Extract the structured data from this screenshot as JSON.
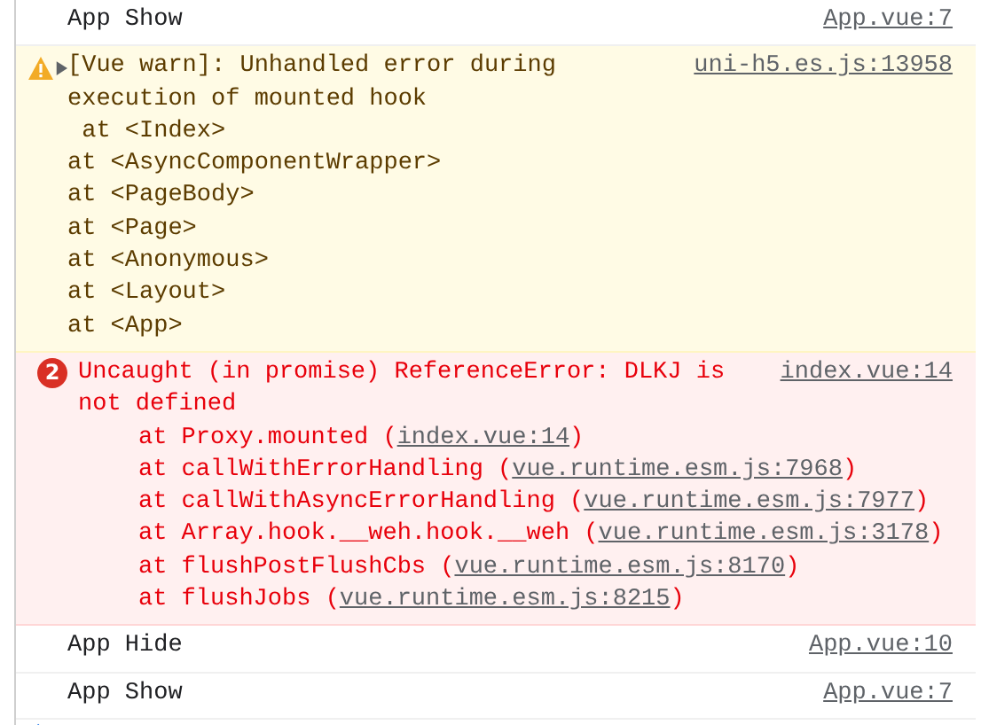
{
  "messages": [
    {
      "kind": "log",
      "text": "App Show",
      "source": "App.vue:7"
    },
    {
      "kind": "warning",
      "expanded": false,
      "text": "[Vue warn]: Unhandled error during execution of mounted hook",
      "source": "uni-h5.es.js:13958",
      "trace": [
        " at <Index>",
        "at <AsyncComponentWrapper>",
        "at <PageBody>",
        "at <Page>",
        "at <Anonymous>",
        "at <Layout>",
        "at <App>"
      ]
    },
    {
      "kind": "error",
      "count": "2",
      "text": "Uncaught (in promise) ReferenceError: DLKJ is not defined",
      "source": "index.vue:14",
      "stack": [
        {
          "prefix": "at Proxy.mounted (",
          "link": "index.vue:14",
          "suffix": ")"
        },
        {
          "prefix": "at callWithErrorHandling (",
          "link": "vue.runtime.esm.js:7968",
          "suffix": ")"
        },
        {
          "prefix": "at callWithAsyncErrorHandling (",
          "link": "vue.runtime.esm.js:7977",
          "suffix": ")"
        },
        {
          "prefix": "at Array.hook.__weh.hook.__weh (",
          "link": "vue.runtime.esm.js:3178",
          "suffix": ")"
        },
        {
          "prefix": "at flushPostFlushCbs (",
          "link": "vue.runtime.esm.js:8170",
          "suffix": ")"
        },
        {
          "prefix": "at flushJobs (",
          "link": "vue.runtime.esm.js:8215",
          "suffix": ")"
        }
      ]
    },
    {
      "kind": "log",
      "text": "App Hide",
      "source": "App.vue:10"
    },
    {
      "kind": "log",
      "text": "App Show",
      "source": "App.vue:7"
    }
  ]
}
